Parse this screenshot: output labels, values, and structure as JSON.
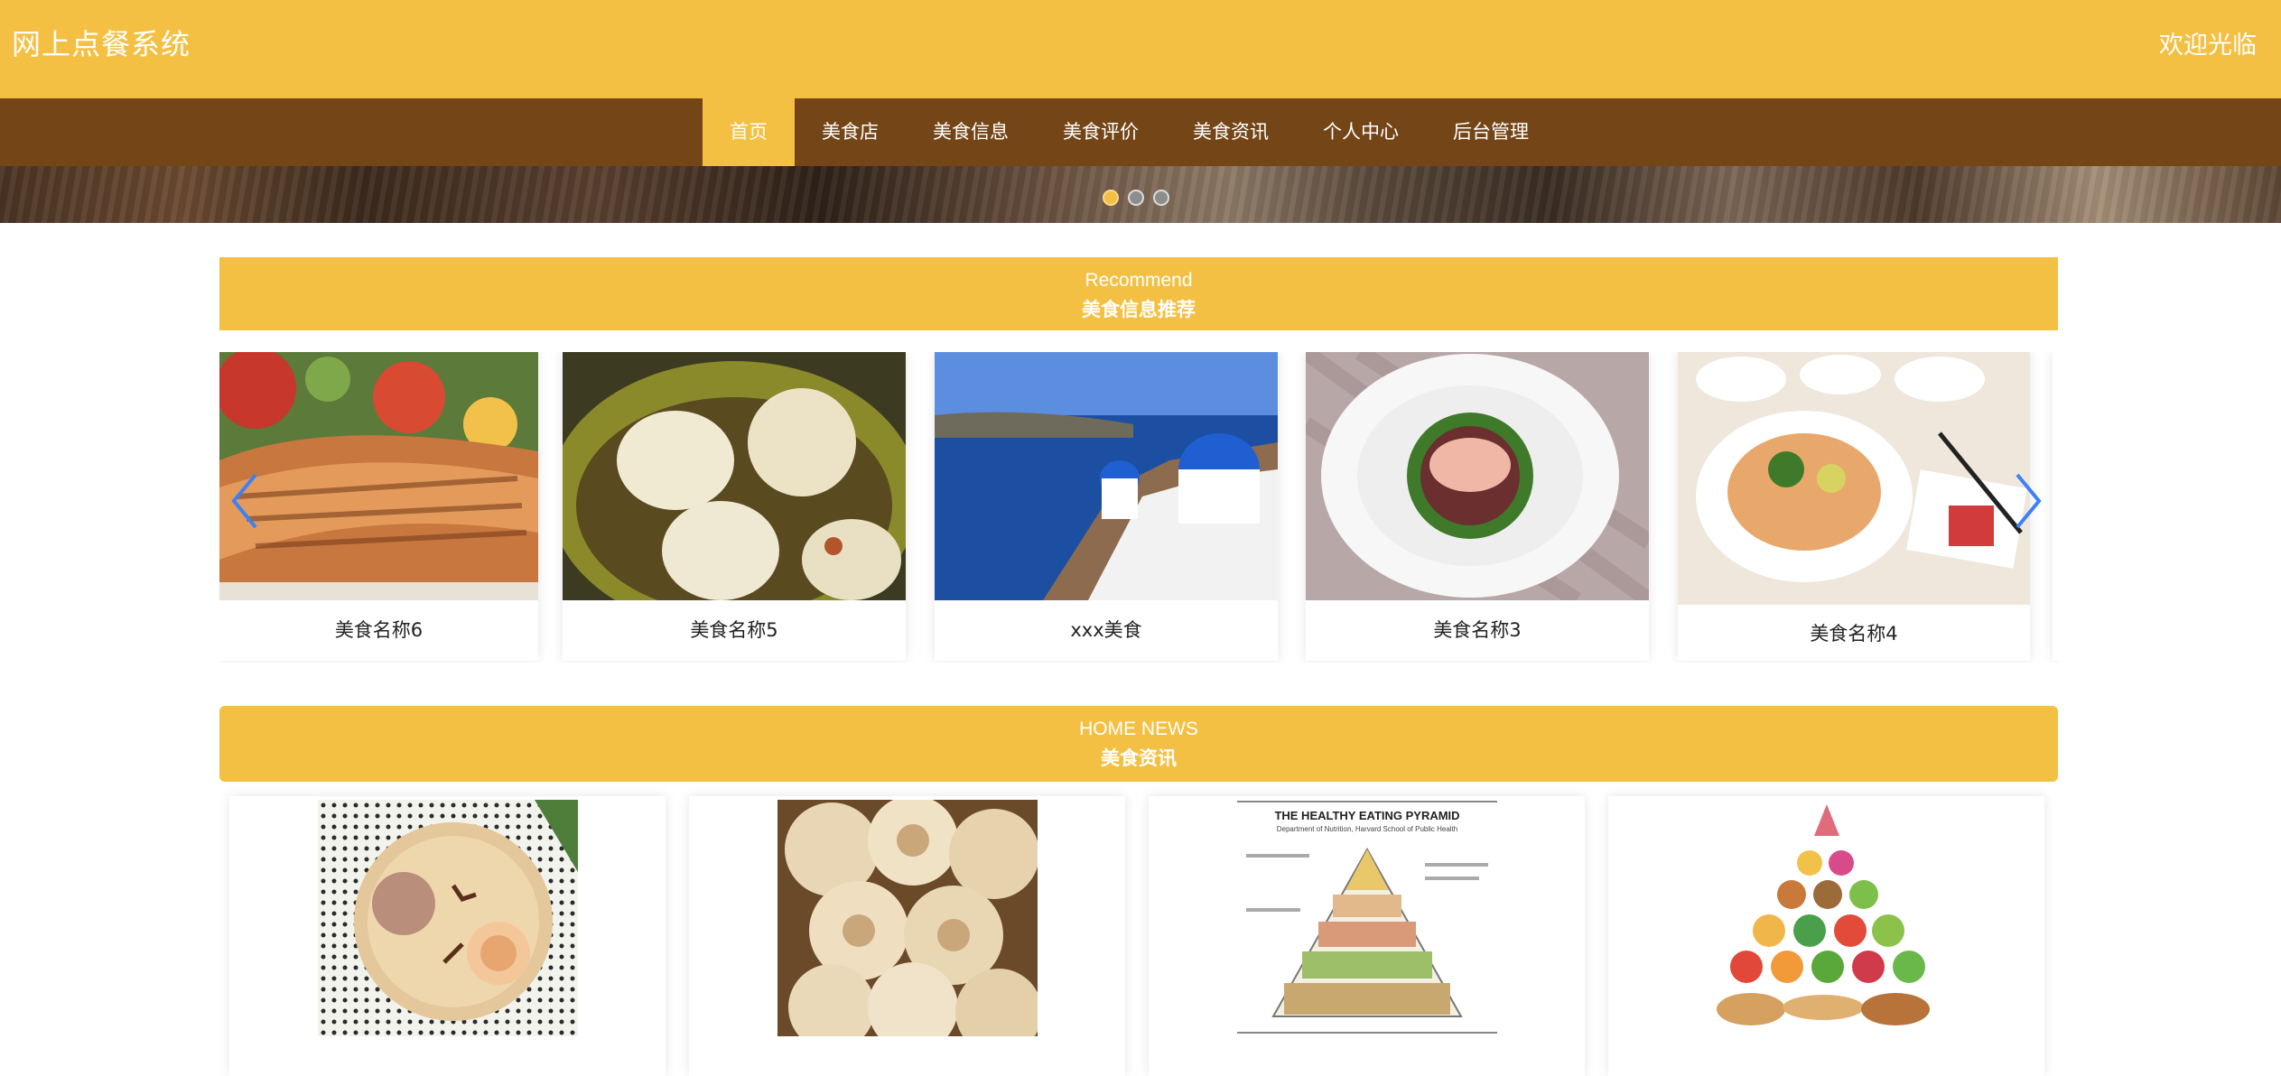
{
  "header": {
    "site_title": "网上点餐系统",
    "welcome_text": "欢迎光临"
  },
  "nav": {
    "items": [
      {
        "label": "首页",
        "active": true
      },
      {
        "label": "美食店",
        "active": false
      },
      {
        "label": "美食信息",
        "active": false
      },
      {
        "label": "美食评价",
        "active": false
      },
      {
        "label": "美食资讯",
        "active": false
      },
      {
        "label": "个人中心",
        "active": false
      },
      {
        "label": "后台管理",
        "active": false
      }
    ]
  },
  "banner": {
    "slides_count": 3,
    "active_slide": 1
  },
  "recommend": {
    "title_en": "Recommend",
    "title_cn": "美食信息推荐",
    "items": [
      {
        "name": "美食名称6",
        "image": "grilled-salmon"
      },
      {
        "name": "美食名称5",
        "image": "steamed-dumplings"
      },
      {
        "name": "xxx美食",
        "image": "santorini-view"
      },
      {
        "name": "美食名称3",
        "image": "fish-dish-plate"
      },
      {
        "name": "美食名称4",
        "image": "noodle-bowl-set"
      }
    ]
  },
  "news": {
    "title_en": "HOME NEWS",
    "title_cn": "美食资讯",
    "items": [
      {
        "image": "dessert-plate"
      },
      {
        "image": "bread-rolls"
      },
      {
        "image": "healthy-eating-pyramid",
        "poster_title": "THE HEALTHY EATING PYRAMID",
        "poster_subtitle": "Department of Nutrition, Harvard School of Public Health"
      },
      {
        "image": "food-pyramid-illustration"
      }
    ]
  },
  "colors": {
    "accent_yellow": "#f4c043",
    "nav_brown": "#744617",
    "text_white": "#ffffff",
    "caption_dark": "#222222",
    "arrow_blue": "#3b82f6"
  }
}
